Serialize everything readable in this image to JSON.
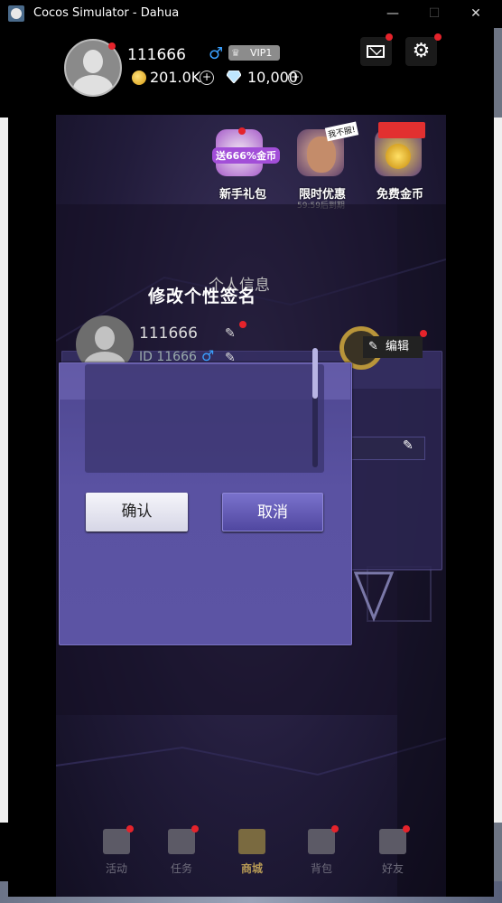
{
  "window": {
    "title": "Cocos Simulator - Dahua",
    "min": "—",
    "max": "☐",
    "close": "✕"
  },
  "header": {
    "username": "111666",
    "vip": "VIP1",
    "coins": "201.0K",
    "gems": "10,000",
    "plus": "+"
  },
  "promos": {
    "gift_badge": "送666%金币",
    "gift_label": "新手礼包",
    "deal_tag": "我不服!",
    "deal_label": "限时优惠",
    "deal_timer": "59:59后到期",
    "free_label": "免费金币"
  },
  "profile": {
    "title": "个人信息",
    "name": "111666",
    "id": "ID 11666",
    "edit_label": "编辑"
  },
  "dialog": {
    "title": "修改个性签名",
    "input_value": "",
    "confirm": "确认",
    "cancel": "取消"
  },
  "nav": [
    {
      "label": "活动"
    },
    {
      "label": "任务"
    },
    {
      "label": "商城"
    },
    {
      "label": "背包"
    },
    {
      "label": "好友"
    }
  ],
  "colors": {
    "accent": "#5c54a4",
    "dot": "#e5232b",
    "coin": "#e0b030"
  }
}
